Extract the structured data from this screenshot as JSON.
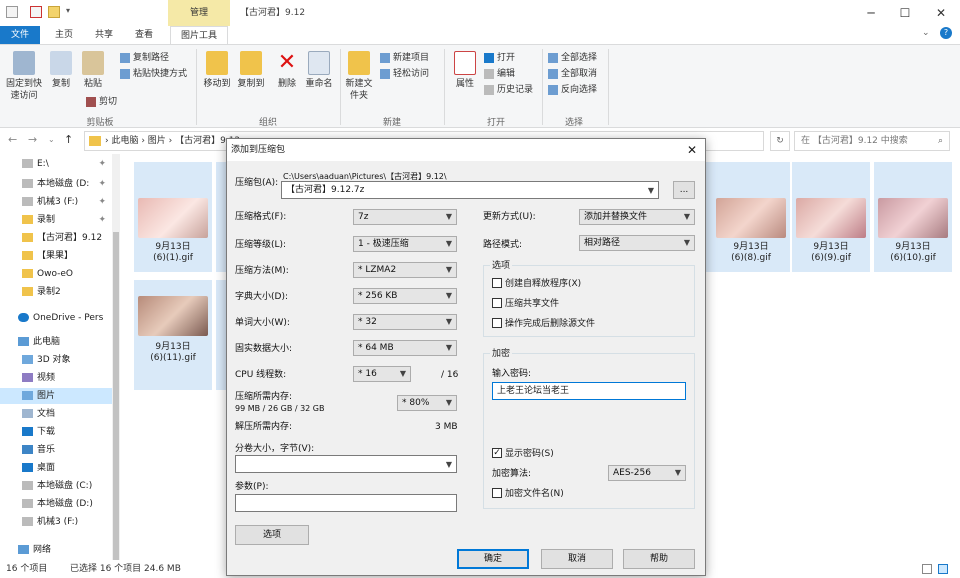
{
  "window": {
    "title": "【古河君】9.12",
    "manage_tab": "管理",
    "minimize": "─",
    "maximize": "☐",
    "close": "✕",
    "help": "?"
  },
  "ribbon_tabs": [
    "文件",
    "主页",
    "共享",
    "查看",
    "图片工具"
  ],
  "ribbon": {
    "clipboard": {
      "pin": "固定到快速访问",
      "copy": "复制",
      "paste": "粘贴",
      "cut": "剪切",
      "copy_path": "复制路径",
      "paste_shortcut": "粘贴快捷方式",
      "group": "剪贴板"
    },
    "organize": {
      "move_to": "移动到",
      "copy_to": "复制到",
      "delete": "删除",
      "rename": "重命名",
      "group": "组织"
    },
    "new": {
      "new_folder": "新建文件夹",
      "new_item": "新建项目",
      "easy_access": "轻松访问",
      "group": "新建"
    },
    "open": {
      "properties": "属性",
      "open": "打开",
      "edit": "编辑",
      "history": "历史记录",
      "group": "打开"
    },
    "select": {
      "select_all": "全部选择",
      "select_none": "全部取消",
      "invert": "反向选择",
      "group": "选择"
    }
  },
  "address": {
    "path": "›  此电脑  ›  图片  ›  【古河君】9.12",
    "search_placeholder": "在 【古河君】9.12 中搜索",
    "refresh": "↻"
  },
  "nav": {
    "items": [
      "E:\\",
      "本地磁盘 (D:",
      "机械3 (F:)",
      "录制",
      "【古河君】9.12",
      "【果果】",
      "Owo-eO",
      "录制2",
      "OneDrive - Pers",
      "此电脑",
      "3D 对象",
      "视频",
      "图片",
      "文档",
      "下载",
      "音乐",
      "桌面",
      "本地磁盘 (C:)",
      "本地磁盘 (D:)",
      "机械3 (F:)",
      "网络"
    ]
  },
  "files": [
    {
      "date": "9月13日",
      "name": "(6)(1).gif"
    },
    {
      "date": "9月13日",
      "name": "(6)(8).gif"
    },
    {
      "date": "9月13日",
      "name": "(6)(9).gif"
    },
    {
      "date": "9月13日",
      "name": "(6)(10).gif"
    },
    {
      "date": "9月13日",
      "name": "(6)(11).gif"
    }
  ],
  "status": {
    "count": "16 个项目",
    "selected": "已选择 16 个项目  24.6 MB"
  },
  "dialog": {
    "title": "添加到压缩包",
    "close": "✕",
    "archive_label": "压缩包(A):",
    "archive_path": "C:\\Users\\aaduan\\Pictures\\【古河君】9.12\\",
    "archive_name": "【古河君】9.12.7z",
    "browse": "...",
    "format_label": "压缩格式(F):",
    "format": "7z",
    "level_label": "压缩等级(L):",
    "level": "1 - 极速压缩",
    "method_label": "压缩方法(M):",
    "method": "* LZMA2",
    "dict_label": "字典大小(D):",
    "dict": "* 256 KB",
    "word_label": "单词大小(W):",
    "word": "* 32",
    "solid_label": "固实数据大小:",
    "solid": "* 64 MB",
    "cpu_label": "CPU 线程数:",
    "cpu": "* 16",
    "cpu_total": "/ 16",
    "mem_label": "压缩所需内存:",
    "mem_value": "99 MB / 26 GB / 32 GB",
    "mem_percent": "* 80%",
    "decomp_label": "解压所需内存:",
    "decomp_value": "3 MB",
    "split_label": "分卷大小，字节(V):",
    "split": "",
    "params_label": "参数(P):",
    "params": "",
    "options_btn": "选项",
    "update_label": "更新方式(U):",
    "update": "添加并替换文件",
    "pathmode_label": "路径模式:",
    "pathmode": "相对路径",
    "options_group": "选项",
    "opt_sfx": "创建自释放程序(X)",
    "opt_shared": "压缩共享文件",
    "opt_delete": "操作完成后删除源文件",
    "enc_group": "加密",
    "password_label": "输入密码:",
    "password": "上老王论坛当老王",
    "show_password": "显示密码(S)",
    "enc_method_label": "加密算法:",
    "enc_method": "AES-256",
    "encrypt_names": "加密文件名(N)",
    "ok": "确定",
    "cancel": "取消",
    "help": "帮助"
  }
}
